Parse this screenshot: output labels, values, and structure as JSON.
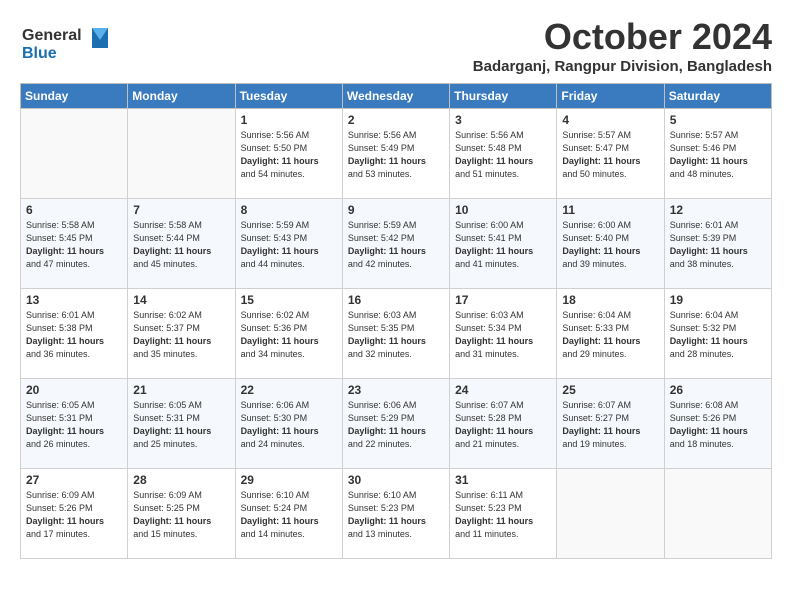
{
  "logo": {
    "line1": "General",
    "line2": "Blue"
  },
  "title": "October 2024",
  "location": "Badarganj, Rangpur Division, Bangladesh",
  "days_of_week": [
    "Sunday",
    "Monday",
    "Tuesday",
    "Wednesday",
    "Thursday",
    "Friday",
    "Saturday"
  ],
  "weeks": [
    [
      {
        "day": "",
        "content": ""
      },
      {
        "day": "",
        "content": ""
      },
      {
        "day": "1",
        "content": "Sunrise: 5:56 AM\nSunset: 5:50 PM\nDaylight: 11 hours\nand 54 minutes."
      },
      {
        "day": "2",
        "content": "Sunrise: 5:56 AM\nSunset: 5:49 PM\nDaylight: 11 hours\nand 53 minutes."
      },
      {
        "day": "3",
        "content": "Sunrise: 5:56 AM\nSunset: 5:48 PM\nDaylight: 11 hours\nand 51 minutes."
      },
      {
        "day": "4",
        "content": "Sunrise: 5:57 AM\nSunset: 5:47 PM\nDaylight: 11 hours\nand 50 minutes."
      },
      {
        "day": "5",
        "content": "Sunrise: 5:57 AM\nSunset: 5:46 PM\nDaylight: 11 hours\nand 48 minutes."
      }
    ],
    [
      {
        "day": "6",
        "content": "Sunrise: 5:58 AM\nSunset: 5:45 PM\nDaylight: 11 hours\nand 47 minutes."
      },
      {
        "day": "7",
        "content": "Sunrise: 5:58 AM\nSunset: 5:44 PM\nDaylight: 11 hours\nand 45 minutes."
      },
      {
        "day": "8",
        "content": "Sunrise: 5:59 AM\nSunset: 5:43 PM\nDaylight: 11 hours\nand 44 minutes."
      },
      {
        "day": "9",
        "content": "Sunrise: 5:59 AM\nSunset: 5:42 PM\nDaylight: 11 hours\nand 42 minutes."
      },
      {
        "day": "10",
        "content": "Sunrise: 6:00 AM\nSunset: 5:41 PM\nDaylight: 11 hours\nand 41 minutes."
      },
      {
        "day": "11",
        "content": "Sunrise: 6:00 AM\nSunset: 5:40 PM\nDaylight: 11 hours\nand 39 minutes."
      },
      {
        "day": "12",
        "content": "Sunrise: 6:01 AM\nSunset: 5:39 PM\nDaylight: 11 hours\nand 38 minutes."
      }
    ],
    [
      {
        "day": "13",
        "content": "Sunrise: 6:01 AM\nSunset: 5:38 PM\nDaylight: 11 hours\nand 36 minutes."
      },
      {
        "day": "14",
        "content": "Sunrise: 6:02 AM\nSunset: 5:37 PM\nDaylight: 11 hours\nand 35 minutes."
      },
      {
        "day": "15",
        "content": "Sunrise: 6:02 AM\nSunset: 5:36 PM\nDaylight: 11 hours\nand 34 minutes."
      },
      {
        "day": "16",
        "content": "Sunrise: 6:03 AM\nSunset: 5:35 PM\nDaylight: 11 hours\nand 32 minutes."
      },
      {
        "day": "17",
        "content": "Sunrise: 6:03 AM\nSunset: 5:34 PM\nDaylight: 11 hours\nand 31 minutes."
      },
      {
        "day": "18",
        "content": "Sunrise: 6:04 AM\nSunset: 5:33 PM\nDaylight: 11 hours\nand 29 minutes."
      },
      {
        "day": "19",
        "content": "Sunrise: 6:04 AM\nSunset: 5:32 PM\nDaylight: 11 hours\nand 28 minutes."
      }
    ],
    [
      {
        "day": "20",
        "content": "Sunrise: 6:05 AM\nSunset: 5:31 PM\nDaylight: 11 hours\nand 26 minutes."
      },
      {
        "day": "21",
        "content": "Sunrise: 6:05 AM\nSunset: 5:31 PM\nDaylight: 11 hours\nand 25 minutes."
      },
      {
        "day": "22",
        "content": "Sunrise: 6:06 AM\nSunset: 5:30 PM\nDaylight: 11 hours\nand 24 minutes."
      },
      {
        "day": "23",
        "content": "Sunrise: 6:06 AM\nSunset: 5:29 PM\nDaylight: 11 hours\nand 22 minutes."
      },
      {
        "day": "24",
        "content": "Sunrise: 6:07 AM\nSunset: 5:28 PM\nDaylight: 11 hours\nand 21 minutes."
      },
      {
        "day": "25",
        "content": "Sunrise: 6:07 AM\nSunset: 5:27 PM\nDaylight: 11 hours\nand 19 minutes."
      },
      {
        "day": "26",
        "content": "Sunrise: 6:08 AM\nSunset: 5:26 PM\nDaylight: 11 hours\nand 18 minutes."
      }
    ],
    [
      {
        "day": "27",
        "content": "Sunrise: 6:09 AM\nSunset: 5:26 PM\nDaylight: 11 hours\nand 17 minutes."
      },
      {
        "day": "28",
        "content": "Sunrise: 6:09 AM\nSunset: 5:25 PM\nDaylight: 11 hours\nand 15 minutes."
      },
      {
        "day": "29",
        "content": "Sunrise: 6:10 AM\nSunset: 5:24 PM\nDaylight: 11 hours\nand 14 minutes."
      },
      {
        "day": "30",
        "content": "Sunrise: 6:10 AM\nSunset: 5:23 PM\nDaylight: 11 hours\nand 13 minutes."
      },
      {
        "day": "31",
        "content": "Sunrise: 6:11 AM\nSunset: 5:23 PM\nDaylight: 11 hours\nand 11 minutes."
      },
      {
        "day": "",
        "content": ""
      },
      {
        "day": "",
        "content": ""
      }
    ]
  ]
}
